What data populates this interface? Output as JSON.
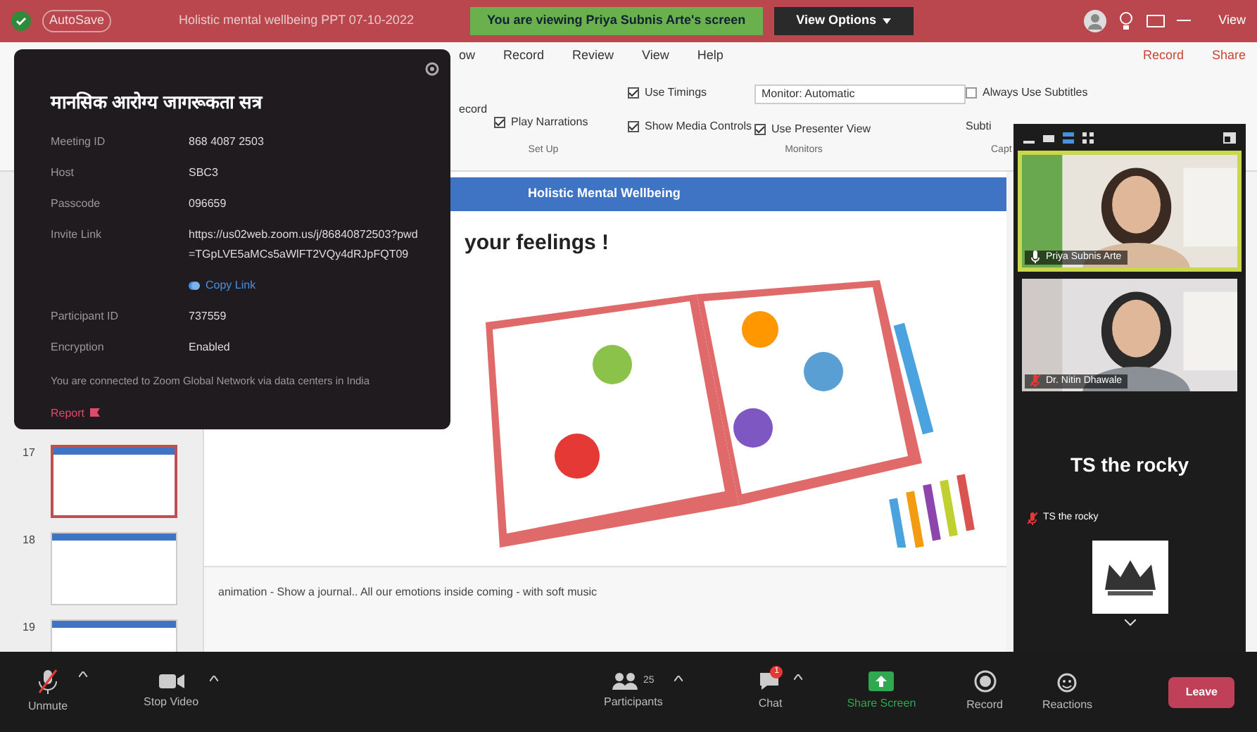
{
  "title_bar": {
    "autosave": "AutoSave",
    "document_title": "Holistic mental wellbeing PPT 07-10-2022",
    "share_banner": "You are viewing Priya Subnis Arte's screen",
    "view_options": "View Options",
    "view": "View"
  },
  "ribbon": {
    "tabs": [
      "ow",
      "Record",
      "Review",
      "View",
      "Help"
    ],
    "record": "Record",
    "share": "Share",
    "partial_label": "ecord",
    "options": [
      {
        "label": "Play Narrations",
        "checked": true
      },
      {
        "label": "Use Timings",
        "checked": true
      },
      {
        "label": "Show Media Controls",
        "checked": true
      },
      {
        "label": "Use Presenter View",
        "checked": true
      },
      {
        "label": "Always Use Subtitles",
        "checked": false
      }
    ],
    "monitor": "Monitor:",
    "monitor_value": "Automatic",
    "subtitle_settings": "Subti",
    "groups": [
      "Set Up",
      "Monitors",
      "Capt"
    ]
  },
  "meeting_info": {
    "title": "मानसिक आरोग्य जागरूकता सत्र",
    "rows": [
      {
        "label": "Meeting ID",
        "value": "868 4087 2503"
      },
      {
        "label": "Host",
        "value": "SBC3"
      },
      {
        "label": "Passcode",
        "value": "096659"
      },
      {
        "label": "Invite Link",
        "value": "https://us02web.zoom.us/j/86840872503?pwd",
        "value_2": "=TGpLVE5aMCs5aWlFT2VQy4dRJpFQT09",
        "action": "Copy Link"
      },
      {
        "label": "Participant ID",
        "value": "737559"
      },
      {
        "label": "Encryption",
        "value": "Enabled"
      }
    ],
    "note": "You are connected to Zoom Global Network via data centers in India",
    "report": "Report"
  },
  "thumbnails": [
    {
      "number": "17",
      "selected": true
    },
    {
      "number": "18",
      "selected": false
    },
    {
      "number": "19",
      "selected": false
    }
  ],
  "slide": {
    "header": "Holistic Mental Wellbeing",
    "title": "your feelings !"
  },
  "notes": "animation - Show a journal.. All our emotions inside coming  - with soft music",
  "video_panel": {
    "tiles": [
      {
        "kind": "video",
        "name": "Priya Subnis Arte",
        "muted": false,
        "active": true
      },
      {
        "kind": "video",
        "name": "Dr. Nitin Dhawale",
        "muted": true,
        "active": false
      },
      {
        "kind": "avatar",
        "title": "TS the rocky",
        "name": "TS the rocky",
        "muted": true,
        "active": false
      }
    ]
  },
  "toolbar": {
    "items": [
      {
        "kind": "mic",
        "label": "Unmute"
      },
      {
        "kind": "camera",
        "label": "Stop Video"
      },
      {
        "kind": "participants",
        "label": "Participants",
        "count": "25"
      },
      {
        "kind": "chat",
        "label": "Chat",
        "badge": "1"
      },
      {
        "kind": "share",
        "label": "Share Screen"
      },
      {
        "kind": "record",
        "label": "Record"
      },
      {
        "kind": "reactions",
        "label": "Reactions"
      }
    ],
    "leave": "Leave"
  }
}
